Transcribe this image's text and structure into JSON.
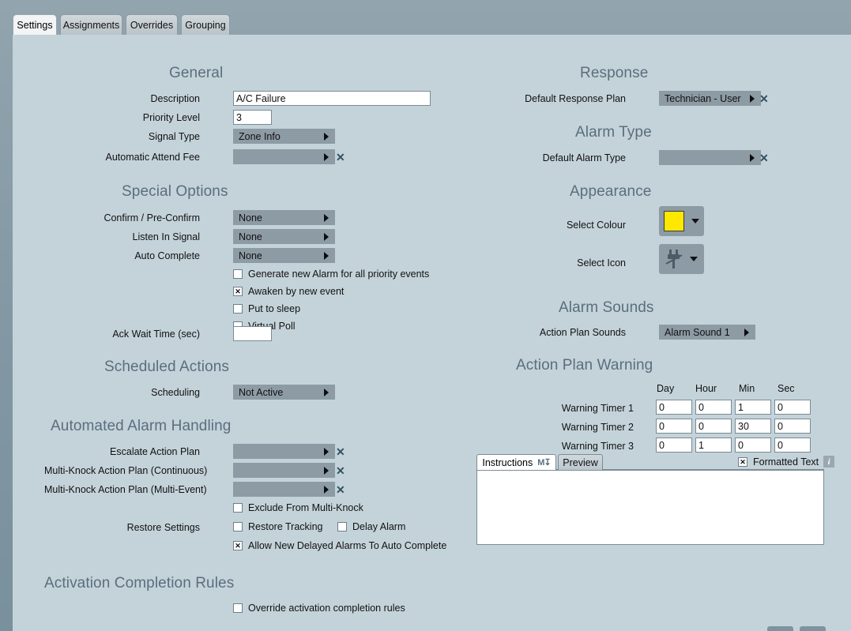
{
  "tabs": [
    {
      "label": "Settings",
      "active": true
    },
    {
      "label": "Assignments",
      "active": false
    },
    {
      "label": "Overrides",
      "active": false
    },
    {
      "label": "Grouping",
      "active": false
    }
  ],
  "colors": {
    "window_bg": "#8297a3",
    "panel_bg": "#c4d3da",
    "dropdown_bg": "#8d9ba5",
    "section_title": "#5a6e7d",
    "selected_colour_swatch": "#ffe800"
  },
  "left_column": {
    "general": {
      "title": "General",
      "fields": {
        "description_label": "Description",
        "description_value": "A/C Failure",
        "priority_label": "Priority Level",
        "priority_value": "3",
        "signal_type_label": "Signal Type",
        "signal_type_value": "Zone Info",
        "attend_fee_label": "Automatic Attend Fee",
        "attend_fee_value": ""
      }
    },
    "special_options": {
      "title": "Special Options",
      "confirm_label": "Confirm / Pre-Confirm",
      "confirm_value": "None",
      "listen_label": "Listen In Signal",
      "listen_value": "None",
      "autocomplete_label": "Auto Complete",
      "autocomplete_value": "None",
      "checkboxes": [
        {
          "label": "Generate new Alarm for all priority events",
          "checked": false
        },
        {
          "label": "Awaken by new event",
          "checked": true
        },
        {
          "label": "Put to sleep",
          "checked": false
        },
        {
          "label": "Virtual Poll",
          "checked": false
        }
      ],
      "ack_wait_label": "Ack Wait Time (sec)",
      "ack_wait_value": ""
    },
    "scheduled_actions": {
      "title": "Scheduled Actions",
      "scheduling_label": "Scheduling",
      "scheduling_value": "Not Active"
    },
    "automated_alarm_handling": {
      "title": "Automated Alarm Handling",
      "escalate_label": "Escalate Action Plan",
      "escalate_value": "",
      "multiknock_cont_label": "Multi-Knock Action Plan (Continuous)",
      "multiknock_cont_value": "",
      "multiknock_multi_label": "Multi-Knock Action Plan (Multi-Event)",
      "multiknock_multi_value": "",
      "exclude_label": "Exclude From Multi-Knock",
      "exclude_checked": false,
      "restore_settings_label": "Restore Settings",
      "restore_tracking_label": "Restore Tracking",
      "restore_tracking_checked": false,
      "delay_alarm_label": "Delay Alarm",
      "delay_alarm_checked": false,
      "allow_auto_complete_label": "Allow New Delayed Alarms To Auto Complete",
      "allow_auto_complete_checked": true
    },
    "activation_completion_rules": {
      "title": "Activation Completion Rules",
      "override_label": "Override activation completion rules",
      "override_checked": false
    }
  },
  "right_column": {
    "response": {
      "title": "Response",
      "default_plan_label": "Default Response Plan",
      "default_plan_value": "Technician - User"
    },
    "alarm_type": {
      "title": "Alarm Type",
      "default_type_label": "Default Alarm Type",
      "default_type_value": ""
    },
    "appearance": {
      "title": "Appearance",
      "select_colour_label": "Select Colour",
      "select_colour_value": "#ffe800",
      "select_icon_label": "Select Icon",
      "select_icon_name": "power-plug-unplugged-icon"
    },
    "alarm_sounds": {
      "title": "Alarm Sounds",
      "action_plan_sounds_label": "Action Plan Sounds",
      "action_plan_sounds_value": "Alarm Sound 1"
    },
    "action_plan_warning": {
      "title": "Action Plan Warning",
      "columns": [
        "Day",
        "Hour",
        "Min",
        "Sec"
      ],
      "rows": [
        {
          "label": "Warning Timer 1",
          "day": "0",
          "hour": "0",
          "min": "1",
          "sec": "0"
        },
        {
          "label": "Warning Timer 2",
          "day": "0",
          "hour": "0",
          "min": "30",
          "sec": "0"
        },
        {
          "label": "Warning Timer 3",
          "day": "0",
          "hour": "1",
          "min": "0",
          "sec": "0"
        }
      ]
    },
    "instructions_editor": {
      "tab_instructions": "Instructions",
      "tab_preview": "Preview",
      "markdown_icon_label": "M",
      "formatted_text_label": "Formatted Text",
      "formatted_text_checked": true,
      "body_value": ""
    }
  }
}
